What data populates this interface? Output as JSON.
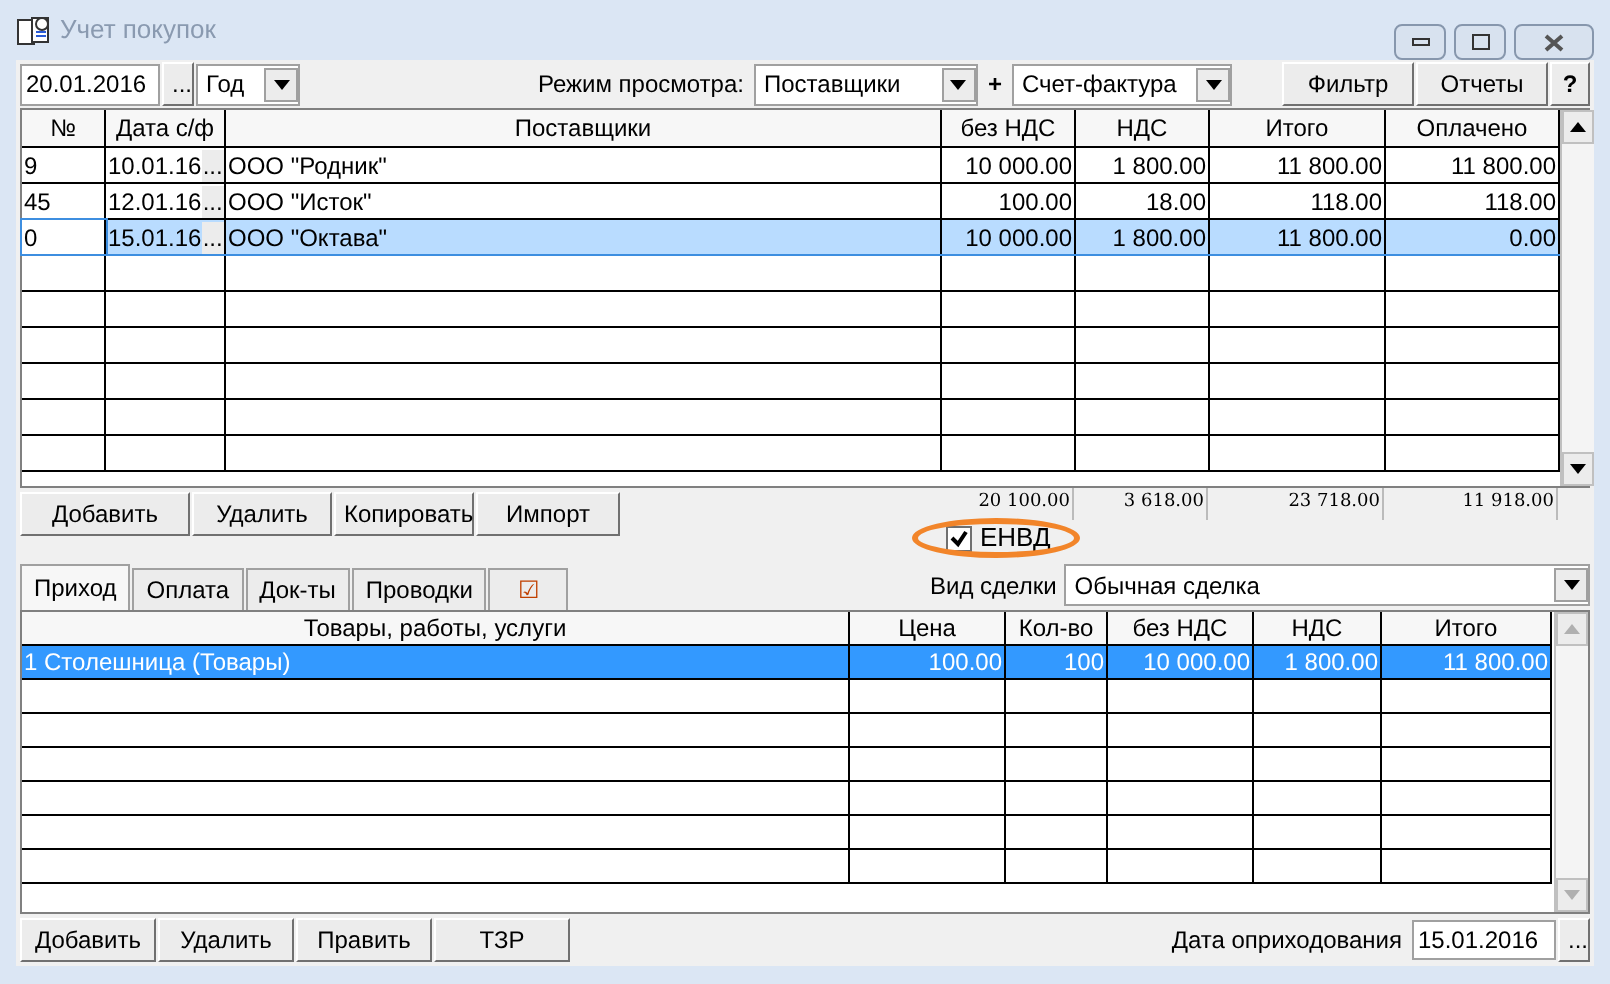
{
  "window": {
    "title": "Учет покупок"
  },
  "toolbar": {
    "date": "20.01.2016",
    "date_button": "...",
    "period": "Год",
    "view_mode_label": "Режим просмотра:",
    "view_mode": "Поставщики",
    "plus": "+",
    "doc_type": "Счет-фактура",
    "buttons": [
      "Фильтр",
      "Отчеты",
      "?"
    ]
  },
  "invoices": {
    "columns": [
      "№",
      "Дата с/ф",
      "Поставщики",
      "без НДС",
      "НДС",
      "Итого",
      "Оплачено"
    ],
    "rows": [
      {
        "cells": [
          "9",
          "10.01.16",
          "ООО \"Родник\"",
          "10 000.00",
          "1 800.00",
          "11 800.00",
          "11 800.00"
        ],
        "selected": false
      },
      {
        "cells": [
          "45",
          "12.01.16",
          "ООО \"Исток\"",
          "100.00",
          "18.00",
          "118.00",
          "118.00"
        ],
        "selected": false
      },
      {
        "cells": [
          "0",
          "15.01.16",
          "ООО \"Октава\"",
          "10 000.00",
          "1 800.00",
          "11 800.00",
          "0.00"
        ],
        "selected": true
      }
    ],
    "date_button": "...",
    "totals": [
      "20 100.00",
      "3 618.00",
      "23 718.00",
      "11 918.00"
    ]
  },
  "invoice_buttons": [
    "Добавить",
    "Удалить",
    "Копировать",
    "Импорт"
  ],
  "envd": {
    "label": "ЕНВД",
    "checked": true,
    "circled": true
  },
  "tabs": [
    {
      "label": "Приход",
      "selected": true
    },
    {
      "label": "Оплата",
      "selected": false
    },
    {
      "label": "Док-ты",
      "selected": false
    },
    {
      "label": "Проводки",
      "selected": false
    },
    {
      "label": "☑",
      "selected": false
    }
  ],
  "deal_type": {
    "label": "Вид сделки",
    "value": "Обычная сделка"
  },
  "items": {
    "columns": [
      "Товары, работы, услуги",
      "Цена",
      "Кол-во",
      "без НДС",
      "НДС",
      "Итого"
    ],
    "rows": [
      {
        "cells": [
          "1 Столешница (Товары)",
          "100.00",
          "100",
          "10 000.00",
          "1 800.00",
          "11 800.00"
        ],
        "selected": true
      }
    ]
  },
  "item_buttons": [
    "Добавить",
    "Удалить",
    "Править",
    "ТЗР"
  ],
  "receipt_date": {
    "label": "Дата оприходования",
    "value": "15.01.2016",
    "button": "..."
  }
}
